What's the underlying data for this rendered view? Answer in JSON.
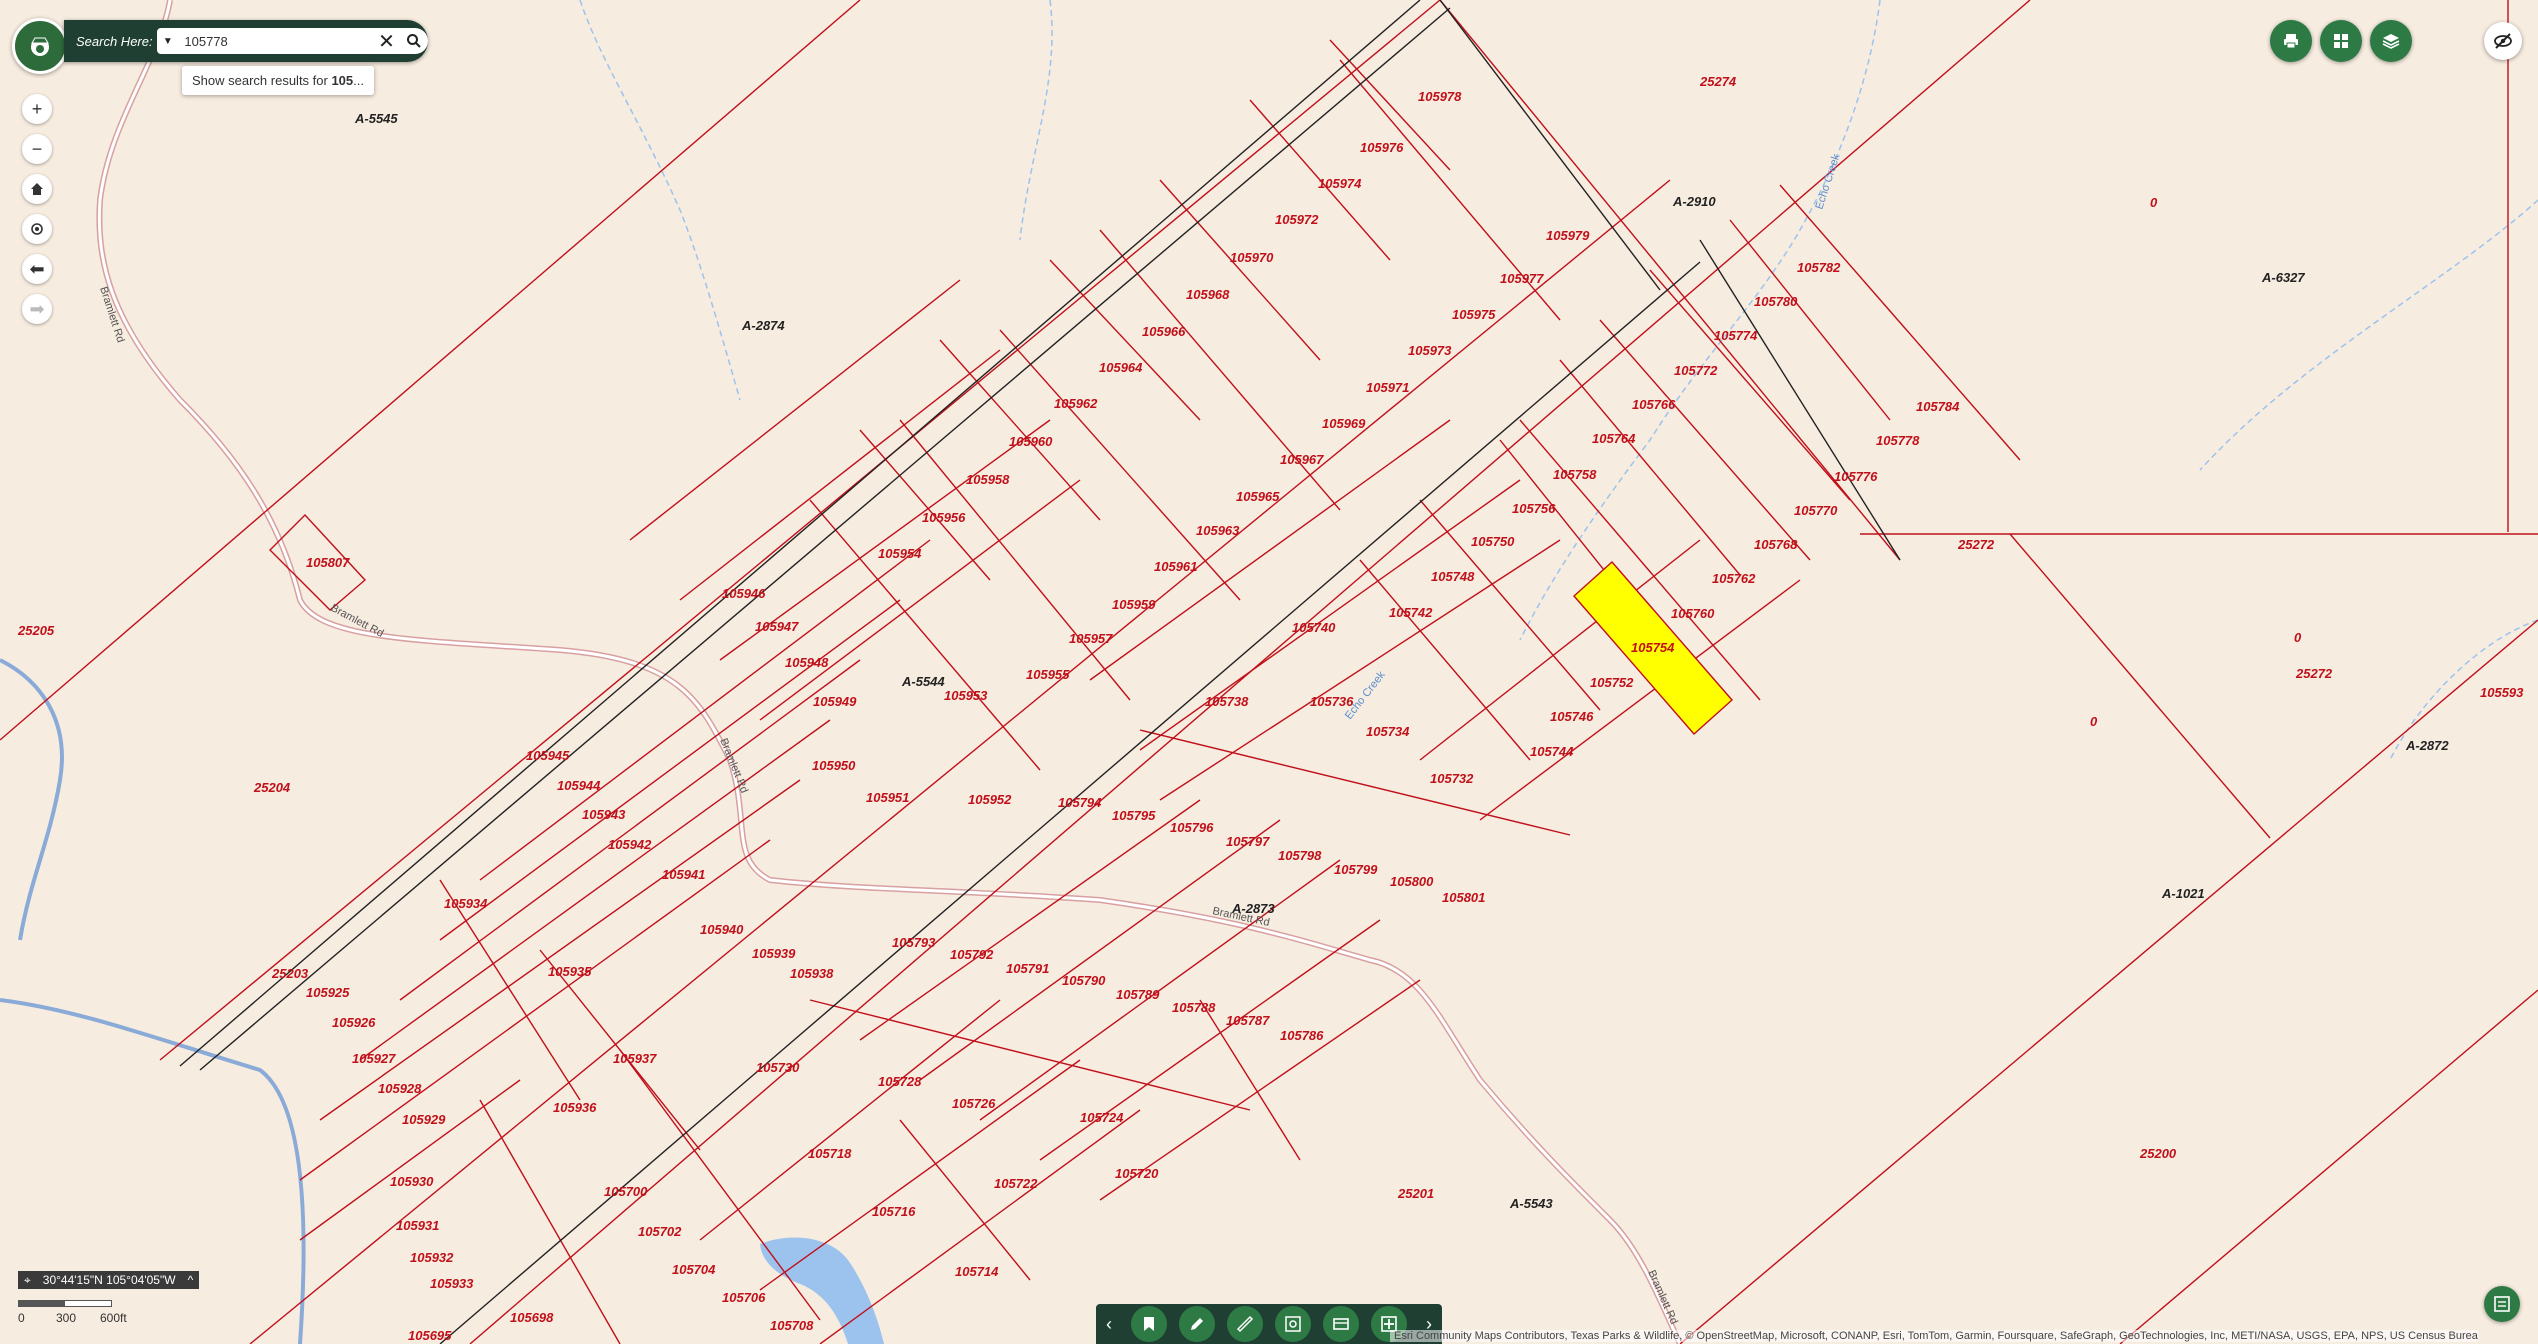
{
  "search": {
    "label": "Search Here:",
    "value": "105778",
    "suggestion_prefix": "Show search results for ",
    "suggestion_bold": "105",
    "suggestion_suffix": "..."
  },
  "coords": "30°44'15\"N 105°04'05\"W",
  "scale": {
    "labels": [
      "0",
      "300",
      "600ft"
    ]
  },
  "attribution": "Esri Community Maps Contributors, Texas Parks & Wildlife, © OpenStreetMap, Microsoft, CONANP, Esri, TomTom, Garmin, Foursquare, SafeGraph, GeoTechnologies, Inc, METI/NASA, USGS, EPA, NPS, US Census Bureau, US...",
  "colors": {
    "parcel_line": "#c0101a",
    "background": "#f7ece0",
    "selected_parcel": "#ffff00",
    "app_green": "#2e7a44",
    "creek": "#9cc3ee"
  },
  "map": {
    "selected_parcel": "105754",
    "abstract_labels": [
      "A-5545",
      "A-2874",
      "A-2910",
      "A-6327",
      "A-5544",
      "A-2873",
      "A-2872",
      "A-1021",
      "A-5543"
    ],
    "parcel_labels": [
      "105978",
      "25274",
      "105976",
      "105974",
      "105972",
      "105970",
      "105968",
      "105966",
      "105964",
      "105962",
      "105960",
      "105958",
      "105956",
      "105954",
      "105979",
      "105977",
      "105975",
      "105973",
      "105971",
      "105969",
      "105967",
      "105965",
      "105963",
      "105961",
      "105959",
      "105957",
      "105955",
      "105953",
      "105782",
      "105780",
      "105774",
      "105772",
      "105766",
      "105764",
      "105758",
      "105756",
      "105750",
      "105748",
      "105742",
      "105740",
      "105738",
      "105736",
      "105734",
      "105732",
      "105784",
      "105778",
      "105776",
      "105770",
      "105768",
      "105762",
      "105760",
      "105754",
      "105752",
      "105746",
      "105744",
      "25272",
      "0",
      "105593",
      "105807",
      "25205",
      "25204",
      "105946",
      "105947",
      "105948",
      "105949",
      "105950",
      "105951",
      "105952",
      "105945",
      "105944",
      "105943",
      "105942",
      "105941",
      "105940",
      "105939",
      "105938",
      "105934",
      "105935",
      "105937",
      "105936",
      "25203",
      "105925",
      "105926",
      "105927",
      "105928",
      "105929",
      "105930",
      "105931",
      "105932",
      "105933",
      "105695",
      "105794",
      "105795",
      "105796",
      "105797",
      "105798",
      "105799",
      "105800",
      "105801",
      "105793",
      "105792",
      "105791",
      "105790",
      "105789",
      "105788",
      "105787",
      "105786",
      "105730",
      "105728",
      "105726",
      "105724",
      "105718",
      "105716",
      "105722",
      "105720",
      "105700",
      "105702",
      "105704",
      "105706",
      "105708",
      "105714",
      "105698",
      "25201",
      "25200"
    ],
    "road_labels": [
      "Bramlett Rd"
    ],
    "creek_labels": [
      "Echo Creek"
    ]
  }
}
